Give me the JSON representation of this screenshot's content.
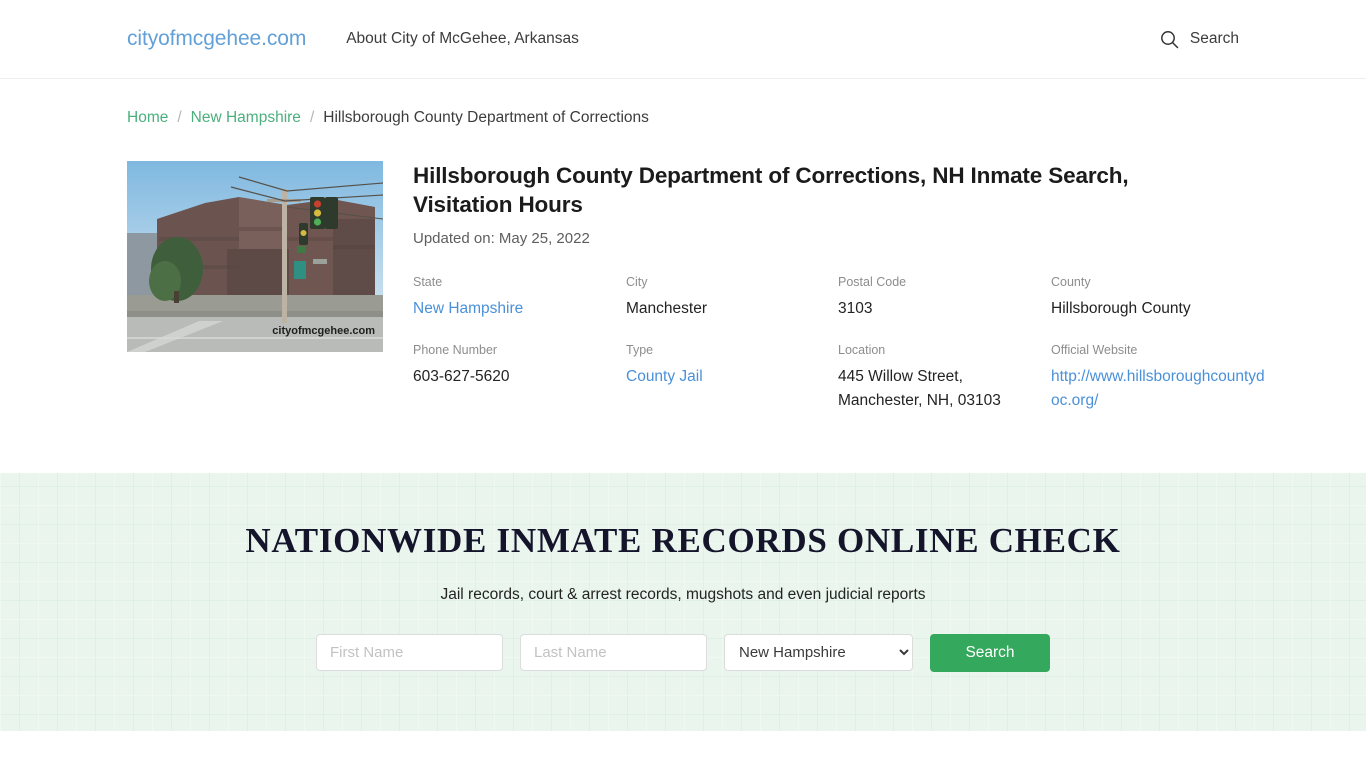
{
  "header": {
    "brand": "cityofmcgehee.com",
    "nav_about": "About City of McGehee, Arkansas",
    "search_label": "Search"
  },
  "breadcrumb": {
    "home": "Home",
    "state": "New Hampshire",
    "current": "Hillsborough County Department of Corrections",
    "separator": "/"
  },
  "article": {
    "title": "Hillsborough County Department of Corrections, NH Inmate Search, Visitation Hours",
    "updated": "Updated on: May 25, 2022",
    "image_caption": "cityofmcgehee.com"
  },
  "facts": {
    "state_label": "State",
    "state_value": "New Hampshire",
    "city_label": "City",
    "city_value": "Manchester",
    "postal_label": "Postal Code",
    "postal_value": "3103",
    "county_label": "County",
    "county_value": "Hillsborough County",
    "phone_label": "Phone Number",
    "phone_value": "603-627-5620",
    "type_label": "Type",
    "type_value": "County Jail",
    "location_label": "Location",
    "location_value": "445 Willow Street, Manchester, NH, 03103",
    "website_label": "Official Website",
    "website_value": "http://www.hillsboroughcountydoc.org/"
  },
  "promo": {
    "title": "NATIONWIDE INMATE RECORDS ONLINE CHECK",
    "subtitle": "Jail records, court & arrest records, mugshots and even judicial reports",
    "first_name_placeholder": "First Name",
    "first_name_value": "",
    "last_name_placeholder": "Last Name",
    "last_name_value": "",
    "state_selected": "New Hampshire",
    "search_button": "Search"
  },
  "colors": {
    "brand_blue": "#63a0d8",
    "link_blue": "#4a90d9",
    "breadcrumb_green": "#4caf7d",
    "button_green": "#34a85c",
    "promo_bg": "#eaf6ed"
  }
}
